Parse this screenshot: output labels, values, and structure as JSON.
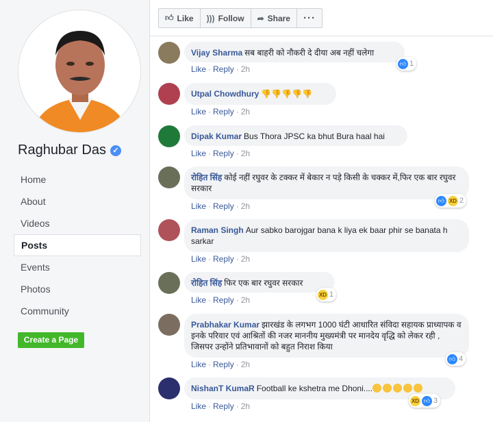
{
  "sidebar": {
    "page_name": "Raghubar Das",
    "nav": [
      "Home",
      "About",
      "Videos",
      "Posts",
      "Events",
      "Photos",
      "Community"
    ],
    "active_nav": "Posts",
    "create_page": "Create a Page"
  },
  "toolbar": {
    "like": "Like",
    "follow": "Follow",
    "share": "Share",
    "more": "···"
  },
  "comment_actions": {
    "like": "Like",
    "reply": "Reply"
  },
  "comments": [
    {
      "author": "Vijay Sharma",
      "text": "सब बाहरी को नौकरी दे दीया अब नहीं चलेगा",
      "time": "2h",
      "reaction_count": "1",
      "avatar_color": "#8a7a5e"
    },
    {
      "author": "Utpal Chowdhury",
      "text": "👎👎👎👎👎",
      "time": "2h",
      "reaction_count": "",
      "avatar_color": "#b0404f"
    },
    {
      "author": "Dipak Kumar",
      "text": "Bus Thora JPSC ka bhut Bura haal hai",
      "time": "2h",
      "reaction_count": "",
      "avatar_color": "#1f7a3a"
    },
    {
      "author": "रोहित सिंह",
      "text": "कोई नहीं रघुवर के टक्कर में बेकार न पड़े किसी के चक्कर में,फिर एक बार रघुवर सरकार",
      "time": "2h",
      "reaction_count": "2",
      "avatar_color": "#6a6f5a"
    },
    {
      "author": "Raman Singh",
      "text": "Aur sabko barojgar bana k liya ek baar phir se banata h sarkar",
      "time": "2h",
      "reaction_count": "",
      "avatar_color": "#b0525a"
    },
    {
      "author": "रोहित सिंह",
      "text": "फिर एक बार रघुवर सरकार",
      "time": "2h",
      "reaction_count": "1",
      "avatar_color": "#6a6f5a"
    },
    {
      "author": "Prabhakar Kumar",
      "text": "झारखंड के लगभग 1000 घंटी आधारित संविदा सहायक प्राध्यापक व इनके परिवार एवं आश्रितों की नजर माननीय मुख्यमंत्री पर मानदेय वृद्धि को लेकर रही , जिसपर उन्होंने प्रतिभावानों को बहुत निराश किया",
      "time": "2h",
      "reaction_count": "4",
      "avatar_color": "#7b6e60"
    },
    {
      "author": "NishanT KumaR",
      "text": "Football ke kshetra me Dhoni....",
      "time": "2h",
      "reaction_count": "3",
      "avatar_color": "#2b2f6e"
    }
  ],
  "colors": {
    "link": "#385898",
    "bubble": "#f2f3f5",
    "create_button": "#42b72a",
    "like_blue": "#2d88ff"
  }
}
